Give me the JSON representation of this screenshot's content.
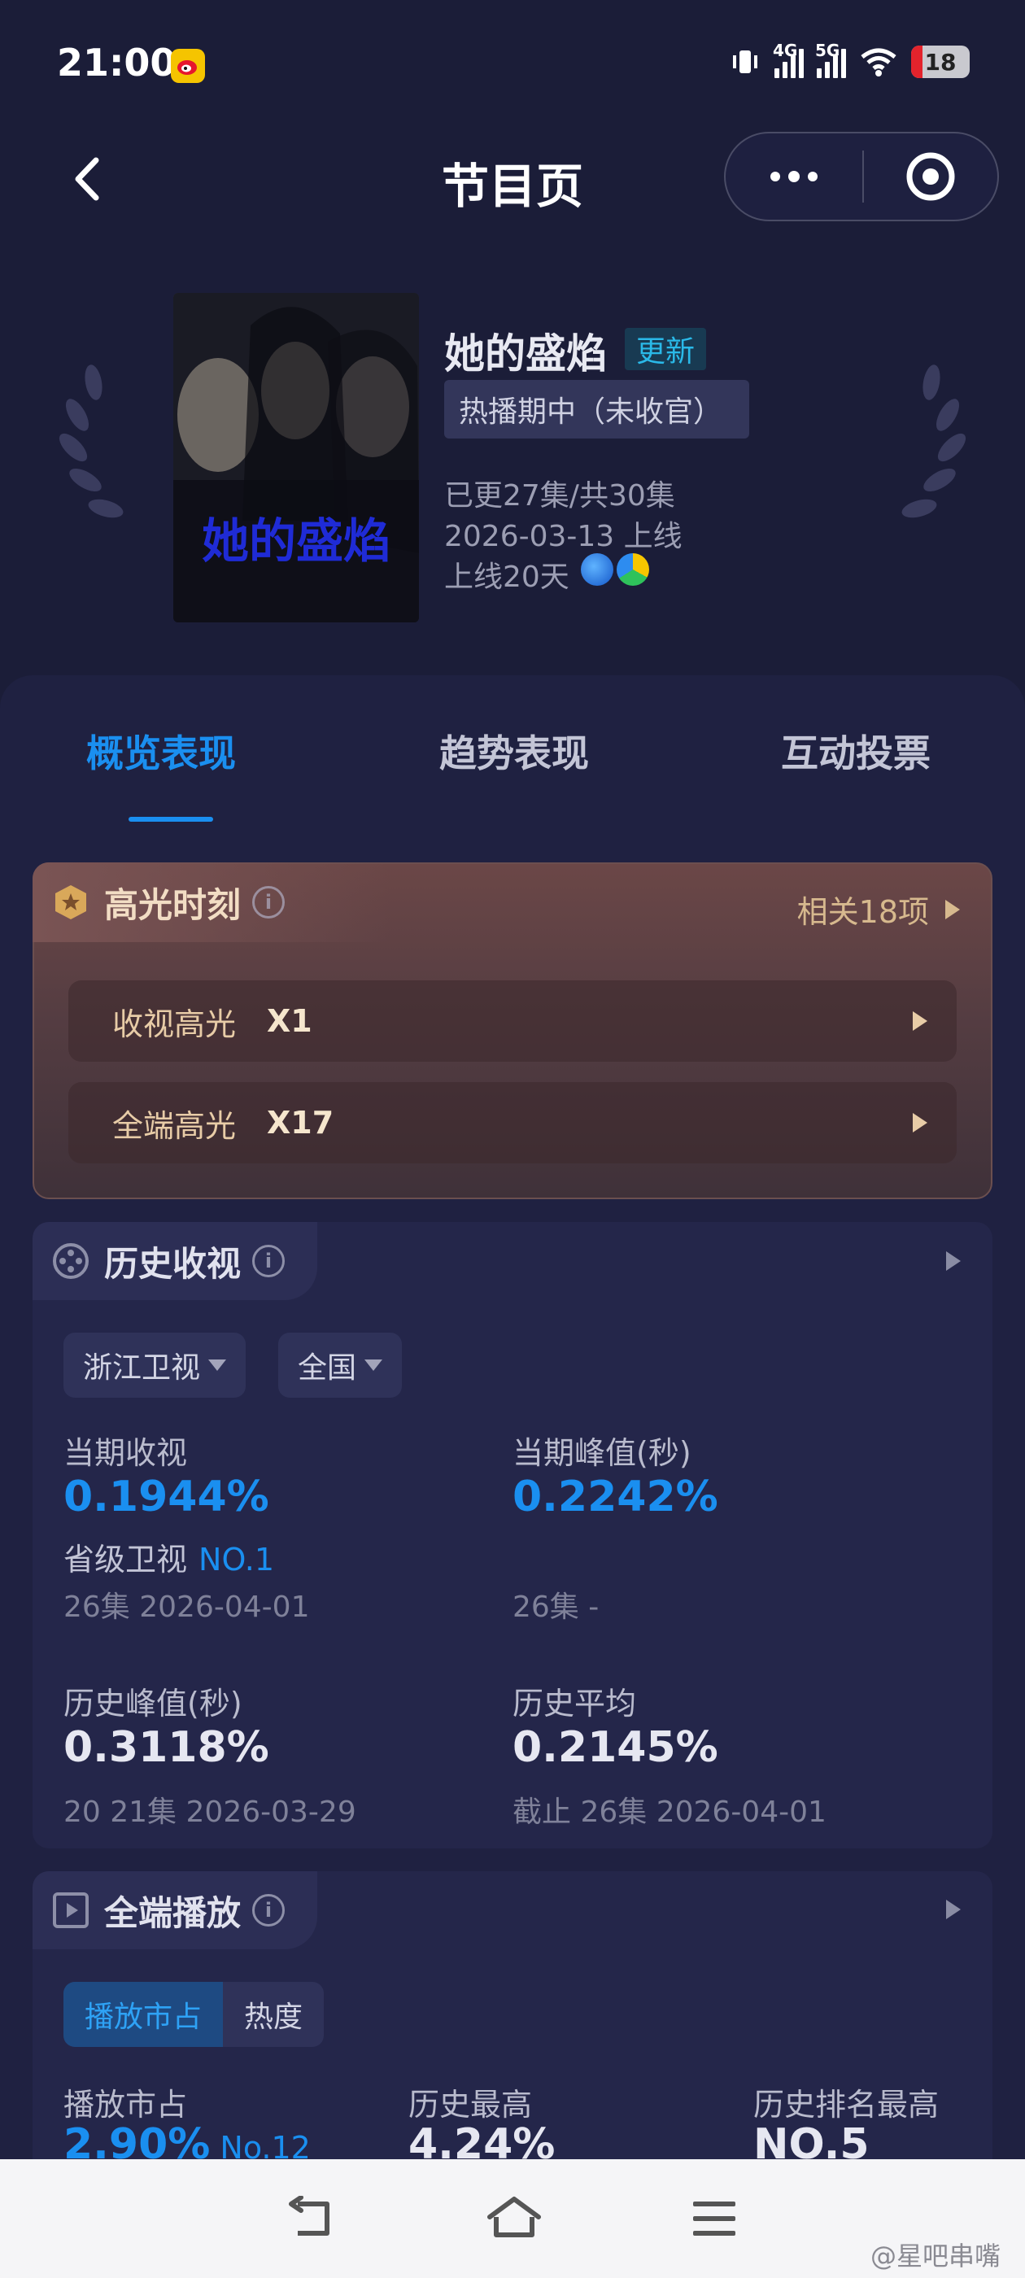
{
  "status_bar": {
    "time": "21:00",
    "net1": "4G",
    "net2": "5G",
    "battery": "18"
  },
  "nav": {
    "title": "节目页"
  },
  "show": {
    "title": "她的盛焰",
    "update_tag": "更新",
    "status": "热播期中（未收官）",
    "episodes": "已更27集/共30集",
    "premiere": "2026-03-13 上线",
    "days_online": "上线20天",
    "poster_text": "她的盛焰"
  },
  "tabs": [
    {
      "label": "概览表现",
      "active": true
    },
    {
      "label": "趋势表现",
      "active": false
    },
    {
      "label": "互动投票",
      "active": false
    }
  ],
  "highlights": {
    "title": "高光时刻",
    "info": "i",
    "related": "相关18项",
    "rows": [
      {
        "label": "收视高光",
        "value": "X1"
      },
      {
        "label": "全端高光",
        "value": "X17"
      }
    ]
  },
  "ratings": {
    "title": "历史收视",
    "info": "i",
    "channel": "浙江卫视",
    "region": "全国",
    "current": {
      "label": "当期收视",
      "value": "0.1944%",
      "rank_label": "省级卫视",
      "rank_value": "NO.1",
      "sub": "26集 2026-04-01"
    },
    "current_peak": {
      "label": "当期峰值(秒)",
      "value": "0.2242%",
      "sub": "26集 -"
    },
    "history_peak": {
      "label": "历史峰值(秒)",
      "value": "0.3118%",
      "sub": "20 21集 2026-03-29"
    },
    "history_avg": {
      "label": "历史平均",
      "value": "0.2145%",
      "sub": "截止 26集 2026-04-01"
    }
  },
  "playback": {
    "title": "全端播放",
    "info": "i",
    "seg_on": "播放市占",
    "seg_off": "热度",
    "share_label": "播放市占",
    "share_value": "2.90%",
    "share_rank": "No.12",
    "max_label": "历史最高",
    "max_value": "4.24%",
    "rank_label": "历史排名最高",
    "rank_value": "NO.5"
  },
  "watermark": "@星吧串嘴",
  "colors": {
    "accent": "#1a8ff0",
    "background": "#1b1d38",
    "highlight_gold": "#e8cca7"
  }
}
